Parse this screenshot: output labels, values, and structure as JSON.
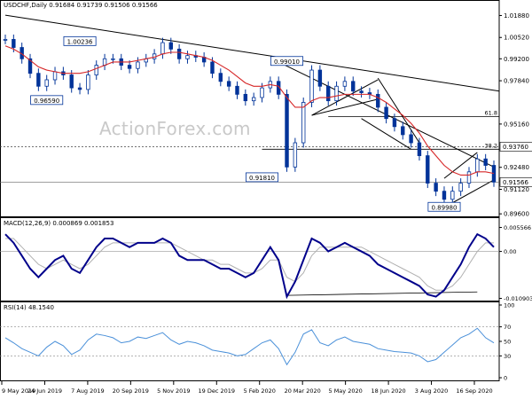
{
  "chart_data": [
    {
      "type": "candlestick",
      "header": "USDCHF,Daily  0.91684 0.91739 0.91506 0.91566",
      "watermark": "ActionForex.com",
      "yticks": [
        0.9012,
        0.9248,
        0.9516,
        0.9784,
        1.0052,
        1.0188
      ],
      "ytick_labels": [
        "0.89600",
        "0.91120",
        "0.92480",
        "0.95160",
        "0.97840",
        "0.99200",
        "1.00520",
        "1.01880"
      ],
      "ylim": [
        0.895,
        1.024
      ],
      "series": [
        {
          "name": "close",
          "color": "#003399",
          "values": [
            1.004,
            0.999,
            0.992,
            0.983,
            0.975,
            0.979,
            0.984,
            0.982,
            0.974,
            0.973,
            0.982,
            0.988,
            0.992,
            0.992,
            0.988,
            0.986,
            0.99,
            0.992,
            0.995,
            1.002,
            0.998,
            0.992,
            0.994,
            0.993,
            0.99,
            0.983,
            0.978,
            0.975,
            0.97,
            0.966,
            0.968,
            0.974,
            0.978,
            0.97,
            0.925,
            0.94,
            0.965,
            0.985,
            0.975,
            0.966,
            0.975,
            0.978,
            0.972,
            0.971,
            0.97,
            0.962,
            0.955,
            0.95,
            0.945,
            0.94,
            0.932,
            0.915,
            0.91,
            0.905,
            0.91,
            0.915,
            0.922,
            0.93,
            0.926,
            0.9157
          ]
        },
        {
          "name": "sma",
          "color": "#d62728",
          "values": [
            1.0,
            0.998,
            0.995,
            0.991,
            0.987,
            0.985,
            0.984,
            0.983,
            0.983,
            0.983,
            0.984,
            0.986,
            0.988,
            0.99,
            0.99,
            0.99,
            0.991,
            0.992,
            0.993,
            0.995,
            0.996,
            0.996,
            0.995,
            0.994,
            0.993,
            0.991,
            0.988,
            0.985,
            0.981,
            0.977,
            0.975,
            0.975,
            0.976,
            0.975,
            0.968,
            0.962,
            0.962,
            0.966,
            0.968,
            0.968,
            0.969,
            0.97,
            0.97,
            0.97,
            0.97,
            0.968,
            0.965,
            0.961,
            0.957,
            0.952,
            0.946,
            0.938,
            0.932,
            0.926,
            0.922,
            0.92,
            0.92,
            0.922,
            0.922,
            0.921
          ]
        }
      ],
      "callouts": [
        {
          "label": "1.00236",
          "x": 9,
          "y": 1.0024
        },
        {
          "label": "0.99010",
          "x": 34,
          "y": 0.9901
        },
        {
          "label": "0.96590",
          "x": 5,
          "y": 0.9659
        },
        {
          "label": "0.91810",
          "x": 31,
          "y": 0.9181
        },
        {
          "label": "0.89980",
          "x": 53,
          "y": 0.8998
        }
      ],
      "fib_labels": [
        "61.8",
        "38.2"
      ],
      "last_price": "0.91566",
      "level_marker": "0.93760"
    },
    {
      "type": "line",
      "header": "MACD(12,26,9) 0.000869 0.001853",
      "ytick_labels": [
        "0.005566",
        "0.00",
        "-0.010903"
      ],
      "ylim": [
        -0.011,
        0.0065
      ],
      "series": [
        {
          "name": "macd",
          "color": "#00008b",
          "values": [
            0.004,
            0.002,
            -0.001,
            -0.004,
            -0.006,
            -0.004,
            -0.002,
            -0.001,
            -0.004,
            -0.005,
            -0.002,
            0.001,
            0.003,
            0.003,
            0.002,
            0.001,
            0.002,
            0.002,
            0.002,
            0.003,
            0.002,
            -0.001,
            -0.002,
            -0.002,
            -0.002,
            -0.003,
            -0.004,
            -0.004,
            -0.005,
            -0.006,
            -0.005,
            -0.002,
            0.001,
            -0.002,
            -0.0105,
            -0.007,
            -0.002,
            0.003,
            0.002,
            0.0,
            0.001,
            0.002,
            0.001,
            0.0,
            -0.001,
            -0.003,
            -0.004,
            -0.005,
            -0.006,
            -0.007,
            -0.008,
            -0.01,
            -0.0105,
            -0.009,
            -0.006,
            -0.003,
            0.001,
            0.004,
            0.003,
            0.001
          ]
        },
        {
          "name": "signal",
          "color": "#b0b0b0",
          "values": [
            0.003,
            0.003,
            0.001,
            -0.001,
            -0.003,
            -0.004,
            -0.003,
            -0.002,
            -0.003,
            -0.004,
            -0.003,
            -0.001,
            0.001,
            0.002,
            0.002,
            0.002,
            0.002,
            0.002,
            0.002,
            0.002,
            0.002,
            0.001,
            0.0,
            -0.001,
            -0.002,
            -0.002,
            -0.003,
            -0.003,
            -0.004,
            -0.005,
            -0.005,
            -0.004,
            -0.002,
            -0.002,
            -0.006,
            -0.007,
            -0.005,
            -0.001,
            0.001,
            0.001,
            0.001,
            0.001,
            0.001,
            0.001,
            0.0,
            -0.001,
            -0.002,
            -0.003,
            -0.004,
            -0.005,
            -0.006,
            -0.008,
            -0.009,
            -0.009,
            -0.008,
            -0.006,
            -0.003,
            0.0,
            0.002,
            0.002
          ]
        }
      ]
    },
    {
      "type": "line",
      "header": "RSI(14) 48.1540",
      "ytick_labels": [
        "100",
        "70",
        "50",
        "30",
        "0"
      ],
      "ylim": [
        0,
        100
      ],
      "series": [
        {
          "name": "rsi",
          "color": "#4a90d9",
          "values": [
            55,
            48,
            40,
            35,
            30,
            42,
            50,
            44,
            32,
            38,
            52,
            60,
            58,
            55,
            48,
            50,
            56,
            54,
            58,
            62,
            52,
            46,
            50,
            48,
            44,
            38,
            36,
            34,
            30,
            32,
            40,
            48,
            52,
            40,
            18,
            35,
            60,
            66,
            48,
            44,
            52,
            56,
            50,
            48,
            46,
            40,
            38,
            36,
            35,
            34,
            30,
            22,
            25,
            35,
            45,
            55,
            60,
            68,
            55,
            48
          ]
        }
      ]
    }
  ],
  "x_axis": {
    "labels": [
      "9 May 2019",
      "24 Jun 2019",
      "7 Aug 2019",
      "20 Sep 2019",
      "5 Nov 2019",
      "19 Dec 2019",
      "5 Feb 2020",
      "20 Mar 2020",
      "5 May 2020",
      "18 Jun 2020",
      "3 Aug 2020",
      "16 Sep 2020"
    ]
  }
}
